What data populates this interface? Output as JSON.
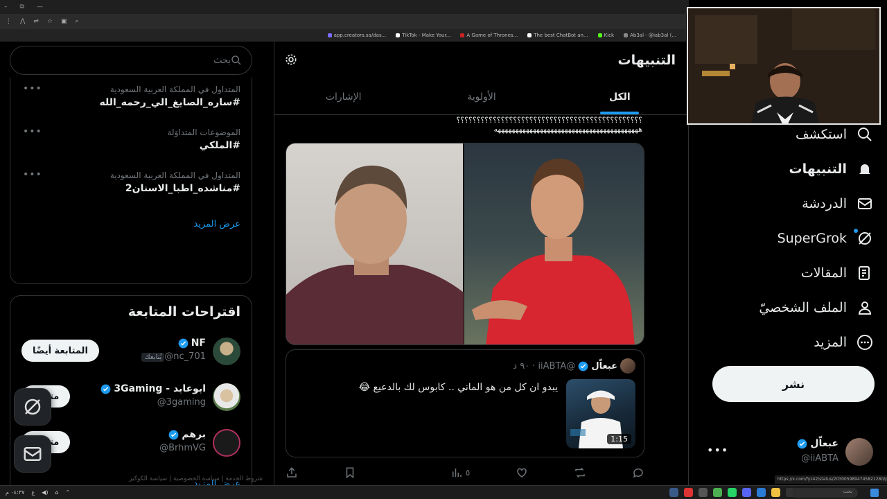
{
  "browser": {
    "bookmarks": [
      {
        "label": "app.creators.sa/das...",
        "color": "#7a6cff"
      },
      {
        "label": "TikTok - Make Your...",
        "color": "#ffffff"
      },
      {
        "label": "A Game of Thrones...",
        "color": "#cc2222"
      },
      {
        "label": "The best ChatBot an...",
        "color": "#ffffff"
      },
      {
        "label": "Kick",
        "color": "#53fc18"
      },
      {
        "label": "Ab3al - @iab3al (...",
        "color": "#888888"
      }
    ],
    "status_url": "https://x.com/fyz42/status/2030059894745821280/photo/1"
  },
  "search": {
    "placeholder": "بحث"
  },
  "trends": [
    {
      "meta": "المتداول في المملكة العربية السعودية",
      "name": "#ساره_الصايغ_الي_رحمه_الله"
    },
    {
      "meta": "الموضوعات المتداوَلة",
      "name": "#الملكي"
    },
    {
      "meta": "المتداول في المملكة العربية السعودية",
      "name": "#مناشده_اطبا_الاسنان2"
    }
  ],
  "trends_show_more": "عرض المزيد",
  "follow": {
    "title": "اقتراحات المتابعة",
    "users": [
      {
        "name": "NF",
        "handle": "@nc_701",
        "tag": "يُتابعك",
        "button": "المتابعة أيضًا"
      },
      {
        "name": "ابوعابد - 3Gaming",
        "handle": "@3gaming",
        "tag": "",
        "button": "متابعة"
      },
      {
        "name": "برهم",
        "handle": "@BrhmVG",
        "tag": "",
        "button": "متابعة"
      }
    ],
    "show_more": "عرض المزيد"
  },
  "footer_text": "شروط الخدمة | سياسة الخصوصية | سياسة الكوكيز",
  "center": {
    "title": "التنبيهات",
    "tabs": [
      "الكل",
      "الأولوية",
      "الإشارات"
    ],
    "post_text_line1": "؟؟؟؟؟؟؟؟؟؟؟؟؟؟؟؟؟؟؟؟؟؟؟؟؟؟؟؟؟؟؟؟؟؟؟؟؟؟؟؟؟؟؟؟؟؟",
    "post_text_line2": "هههههههههههههههههههههههههههههههههههههههههه",
    "quote": {
      "name": "عبعاّل",
      "handle": "@iiABTA",
      "time": "٩٠ د",
      "text": "يبدو ان كل من هو الماني .. كابوس لك بالدعيع 😂",
      "duration": "1:15"
    },
    "actions": {
      "views": "٥"
    }
  },
  "nav": {
    "items": [
      {
        "label": "استكشف",
        "icon": "search-icon"
      },
      {
        "label": "التنبيهات",
        "icon": "bell-icon"
      },
      {
        "label": "الدردشة",
        "icon": "mail-icon"
      },
      {
        "label": "SuperGrok",
        "icon": "grok-icon"
      },
      {
        "label": "المقالات",
        "icon": "article-icon"
      },
      {
        "label": "الملف الشخصيّ",
        "icon": "profile-icon"
      },
      {
        "label": "المزيد",
        "icon": "more-icon"
      }
    ],
    "post_button": "نشر",
    "account": {
      "name": "عبعاّل",
      "handle": "@iiABTA"
    }
  },
  "taskbar": {
    "search_placeholder": "بحث",
    "time": "٠٤:٣٧ م",
    "date": "٢٠٢٦/٠٣/٠٧"
  },
  "colors": {
    "accent": "#1d9bf0",
    "bg": "#000000",
    "border": "#2f3336"
  }
}
